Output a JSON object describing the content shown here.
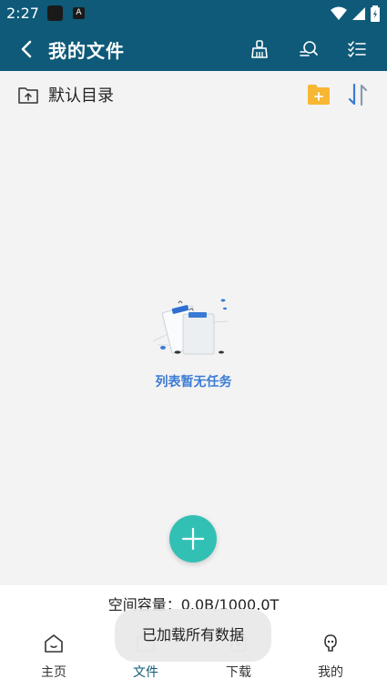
{
  "status_bar": {
    "time": "2:27",
    "notif_icon_2": "A"
  },
  "app_bar": {
    "title": "我的文件"
  },
  "directory": {
    "name": "默认目录"
  },
  "empty_state": {
    "message": "列表暂无任务"
  },
  "storage": {
    "capacity_text": "空间容量：0.0B/1000.0T"
  },
  "nav": {
    "items": [
      {
        "label": "主页",
        "icon": "home-icon"
      },
      {
        "label": "文件",
        "icon": "folder-icon"
      },
      {
        "label": "下载",
        "icon": "download-icon"
      },
      {
        "label": "我的",
        "icon": "profile-icon"
      }
    ],
    "active_index": 1
  },
  "toast": {
    "message": "已加载所有数据"
  },
  "colors": {
    "primary": "#0e5a78",
    "fab": "#33c0b4",
    "folder": "#f7b733",
    "accent_blue": "#3a7bd5"
  }
}
